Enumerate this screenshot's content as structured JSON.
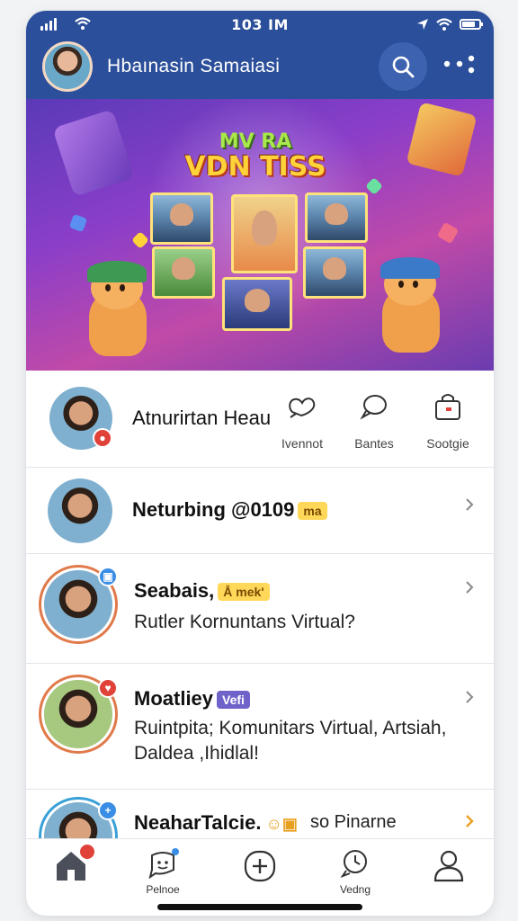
{
  "status_bar": {
    "time": "103 IM"
  },
  "header": {
    "title": "Hbaınasin Samaiasi",
    "icons": [
      "search-icon",
      "more-dots-icon"
    ],
    "color": "#2b4f9a"
  },
  "banner": {
    "title_line1": "MV RA",
    "title_line2": "VDN TISS"
  },
  "profile_row": {
    "name": "Atnurirtan Heau",
    "actions": [
      {
        "label": "Ivennot",
        "icon": "heart-outline-icon"
      },
      {
        "label": "Bantes",
        "icon": "chat-bubble-icon"
      },
      {
        "label": "Sootgie",
        "icon": "bag-icon"
      }
    ]
  },
  "list": [
    {
      "title": "Neturbing @0109",
      "tag": "ma",
      "subtitle": "",
      "subtitle2": ""
    },
    {
      "title": "Seabais,",
      "tag": "Å mek'",
      "subtitle": "Rutler Kornuntans Virtual?",
      "subtitle2": ""
    },
    {
      "title": "Moatliey",
      "tag": "Vefi",
      "subtitle": "Ruintpita; Komunitars Virtual, Artsiah,",
      "subtitle2": "Daldea ,Ihidlal!"
    },
    {
      "title": "NeaharTalcie.",
      "tag": "",
      "subtitle": "so Pinarne",
      "subtitle2": ""
    }
  ],
  "bottom_nav": [
    {
      "label": "",
      "icon": "home-icon"
    },
    {
      "label": "Pelnoe",
      "icon": "chat-face-icon"
    },
    {
      "label": "",
      "icon": "plus-circle-icon"
    },
    {
      "label": "Vedng",
      "icon": "clock-icon"
    },
    {
      "label": "",
      "icon": "profile-icon"
    }
  ],
  "colors": {
    "accent": "#2b4f9a",
    "notify_red": "#e0423a",
    "notify_blue": "#3a8ee6",
    "tag_yellow": "#ffd85a",
    "tag_purple": "#6f63c9"
  }
}
